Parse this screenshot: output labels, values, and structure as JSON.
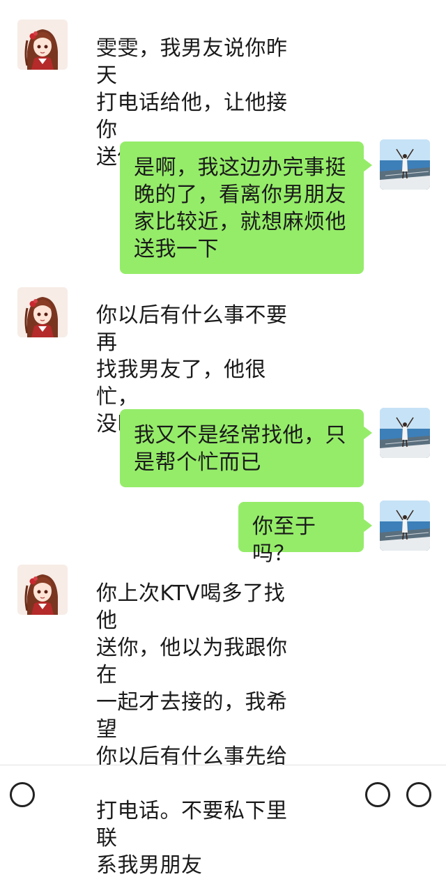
{
  "messages": [
    {
      "side": "left",
      "text": "雯雯，我男友说你昨天\n打电话给他，让他接你\n送你回家是吗？"
    },
    {
      "side": "right",
      "text": "是啊，我这边办完事挺\n晚的了，看离你男朋友\n家比较近，就想麻烦他\n送我一下"
    },
    {
      "side": "left",
      "text": "你以后有什么事不要再\n找我男友了，他很忙，\n没时间。"
    },
    {
      "side": "right",
      "text": "我又不是经常找他，只\n是帮个忙而已"
    },
    {
      "side": "right",
      "text": "你至于吗？"
    },
    {
      "side": "left",
      "text": "你上次KTV喝多了找他\n送你，他以为我跟你在\n一起才去接的，我希望\n你以后有什么事先给我\n打电话。不要私下里联\n系我男朋友"
    }
  ],
  "avatars": {
    "left": "anime-girl-avatar",
    "right": "seaside-girl-avatar"
  },
  "colors": {
    "bubble_out": "#95ec69",
    "background": "#ffffff",
    "text": "#1a1a1a"
  },
  "bottom_bar": {
    "icons": [
      "voice-icon",
      "emoji-icon",
      "add-icon"
    ]
  }
}
